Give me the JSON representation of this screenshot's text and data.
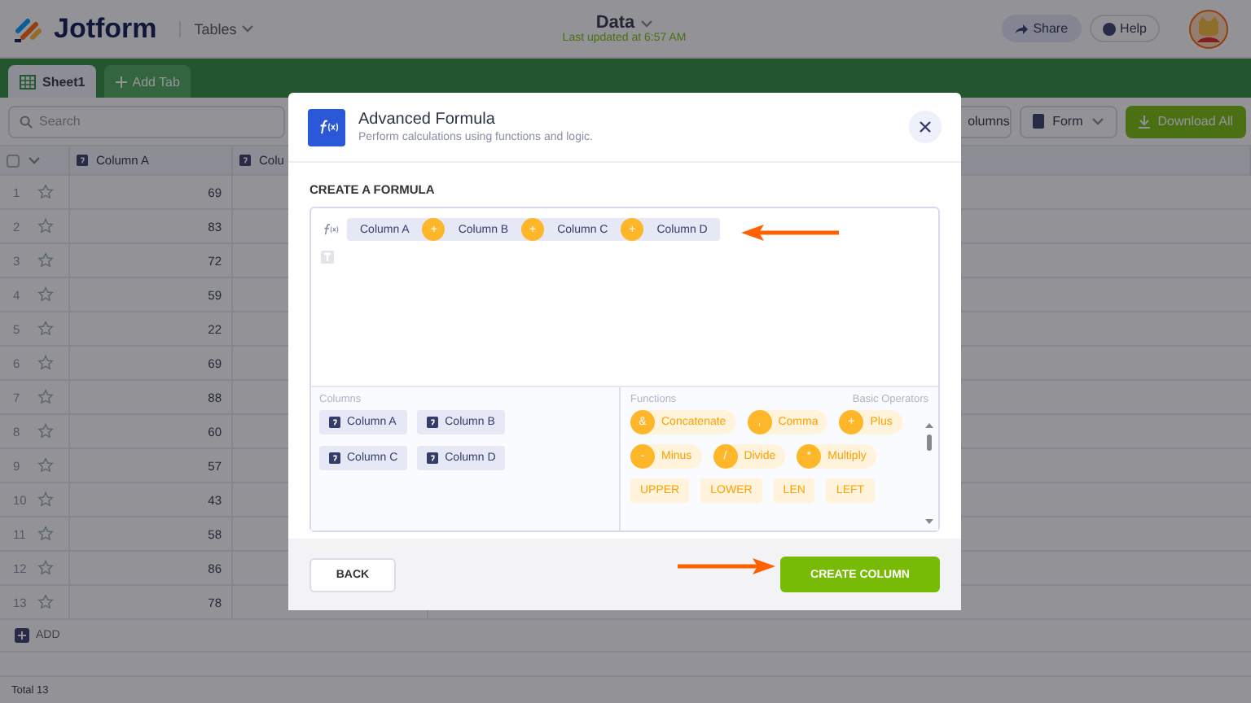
{
  "header": {
    "logo": "Jotform",
    "app_menu": "Tables",
    "title": "Data",
    "last_updated": "Last updated at 6:57 AM",
    "share": "Share",
    "help": "Help"
  },
  "tabs": [
    {
      "label": "Sheet1",
      "selected": true
    }
  ],
  "add_tab": "Add Tab",
  "toolbar": {
    "search_placeholder": "Search",
    "columns": "olumns",
    "form": "Form",
    "download": "Download All"
  },
  "table": {
    "select_all": {
      "checked": false
    },
    "columns": [
      "Column A",
      "Colu"
    ],
    "rows": [
      {
        "number": "1",
        "value": "69",
        "starred": false
      },
      {
        "number": "2",
        "value": "83",
        "starred": false
      },
      {
        "number": "3",
        "value": "72",
        "starred": false
      },
      {
        "number": "4",
        "value": "59",
        "starred": false
      },
      {
        "number": "5",
        "value": "22",
        "starred": false
      },
      {
        "number": "6",
        "value": "69",
        "starred": false
      },
      {
        "number": "7",
        "value": "88",
        "starred": false
      },
      {
        "number": "8",
        "value": "60",
        "starred": false
      },
      {
        "number": "9",
        "value": "57",
        "starred": false
      },
      {
        "number": "10",
        "value": "43",
        "starred": false
      },
      {
        "number": "11",
        "value": "58",
        "starred": false
      },
      {
        "number": "12",
        "value": "86",
        "starred": false
      },
      {
        "number": "13",
        "value": "78",
        "starred": false
      }
    ],
    "add": "ADD",
    "total": "Total 13"
  },
  "modal": {
    "title": "Advanced Formula",
    "subtitle": "Perform calculations using functions and logic.",
    "section": "CREATE A FORMULA",
    "formula": [
      {
        "kind": "column",
        "label": "Column A"
      },
      {
        "kind": "operator",
        "label": "+"
      },
      {
        "kind": "column",
        "label": "Column B"
      },
      {
        "kind": "operator",
        "label": "+"
      },
      {
        "kind": "column",
        "label": "Column C"
      },
      {
        "kind": "operator",
        "label": "+"
      },
      {
        "kind": "column",
        "label": "Column D"
      }
    ],
    "columns_heading": "Columns",
    "columns": [
      "Column A",
      "Column B",
      "Column C",
      "Column D"
    ],
    "functions_heading": "Functions",
    "operators_heading": "Basic Operators",
    "operators": [
      {
        "symbol": "&",
        "label": "Concatenate"
      },
      {
        "symbol": ",",
        "label": "Comma"
      },
      {
        "symbol": "+",
        "label": "Plus"
      },
      {
        "symbol": "-",
        "label": "Minus"
      },
      {
        "symbol": "/",
        "label": "Divide"
      },
      {
        "symbol": "*",
        "label": "Multiply"
      }
    ],
    "functions": [
      "UPPER",
      "LOWER",
      "LEN",
      "LEFT"
    ],
    "back": "BACK",
    "create": "CREATE COLUMN"
  }
}
